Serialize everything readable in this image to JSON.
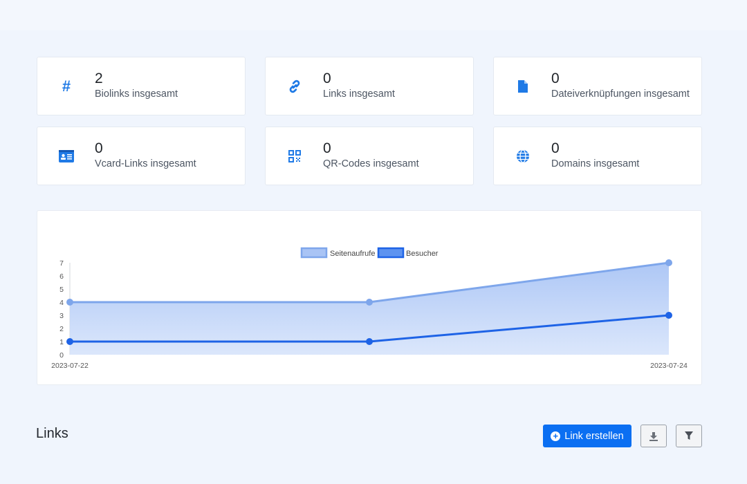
{
  "stats": [
    {
      "value": "2",
      "label": "Biolinks insgesamt",
      "icon": "hash-icon"
    },
    {
      "value": "0",
      "label": "Links insgesamt",
      "icon": "link-icon"
    },
    {
      "value": "0",
      "label": "Dateiverknüpfungen insgesamt",
      "icon": "file-icon"
    },
    {
      "value": "0",
      "label": "Vcard-Links insgesamt",
      "icon": "id-card-icon"
    },
    {
      "value": "0",
      "label": "QR-Codes insgesamt",
      "icon": "qrcode-icon"
    },
    {
      "value": "0",
      "label": "Domains insgesamt",
      "icon": "globe-icon"
    }
  ],
  "colors": {
    "accent": "#1f7ae6",
    "primary_button": "#0b6ff2",
    "series_pageviews": "#7ea6eb",
    "series_visitors": "#1e63e6"
  },
  "chart_data": {
    "type": "area",
    "x": [
      "2023-07-22",
      "2023-07-23",
      "2023-07-24"
    ],
    "x_tick_labels": [
      "2023-07-22",
      "2023-07-24"
    ],
    "series": [
      {
        "name": "Seitenaufrufe",
        "values": [
          4,
          4,
          7
        ]
      },
      {
        "name": "Besucher",
        "values": [
          1,
          1,
          3
        ]
      }
    ],
    "y_ticks": [
      "0",
      "1",
      "2",
      "3",
      "4",
      "5",
      "6",
      "7"
    ],
    "ylim": [
      0,
      7
    ],
    "legend_position": "top-center",
    "grid": false
  },
  "links_section": {
    "title": "Links",
    "create_button": "Link erstellen",
    "export_icon": "download-icon",
    "filter_icon": "filter-icon"
  }
}
